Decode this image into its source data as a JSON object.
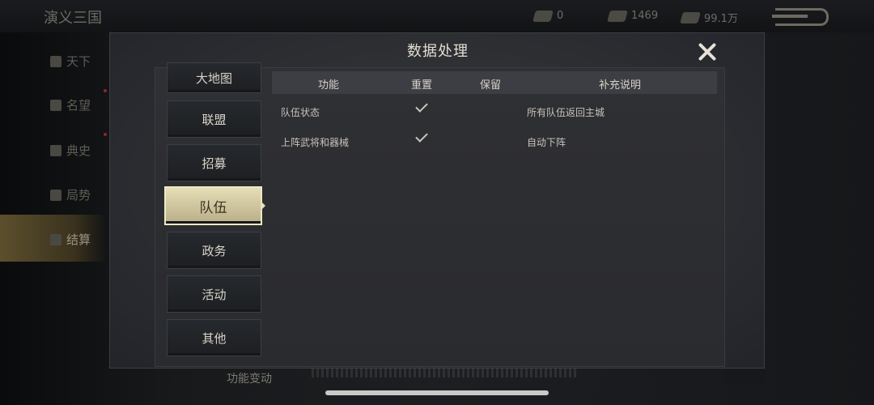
{
  "app_title": "演义三国",
  "resources": [
    {
      "icon": "gold-ingot-icon",
      "value": "0"
    },
    {
      "icon": "copper-coin-icon",
      "value": "1469"
    },
    {
      "icon": "wealth-icon",
      "value": "99.1万"
    }
  ],
  "left_nav": [
    {
      "label": "天下",
      "icon": "world-icon"
    },
    {
      "label": "名望",
      "icon": "fame-icon"
    },
    {
      "label": "典史",
      "icon": "history-icon"
    },
    {
      "label": "局势",
      "icon": "situation-icon"
    },
    {
      "label": "结算",
      "icon": "settlement-icon",
      "active": true
    }
  ],
  "bottom_text": "功能变动",
  "dialog": {
    "title": "数据处理",
    "tabs": [
      {
        "label": "大地图"
      },
      {
        "label": "联盟"
      },
      {
        "label": "招募"
      },
      {
        "label": "队伍",
        "active": true
      },
      {
        "label": "政务"
      },
      {
        "label": "活动"
      },
      {
        "label": "其他"
      }
    ],
    "table": {
      "headers": [
        "功能",
        "重置",
        "保留",
        "补充说明"
      ],
      "rows": [
        {
          "function": "队伍状态",
          "reset": true,
          "keep": false,
          "note": "所有队伍返回主城"
        },
        {
          "function": "上阵武将和器械",
          "reset": true,
          "keep": false,
          "note": "自动下阵"
        }
      ]
    }
  }
}
